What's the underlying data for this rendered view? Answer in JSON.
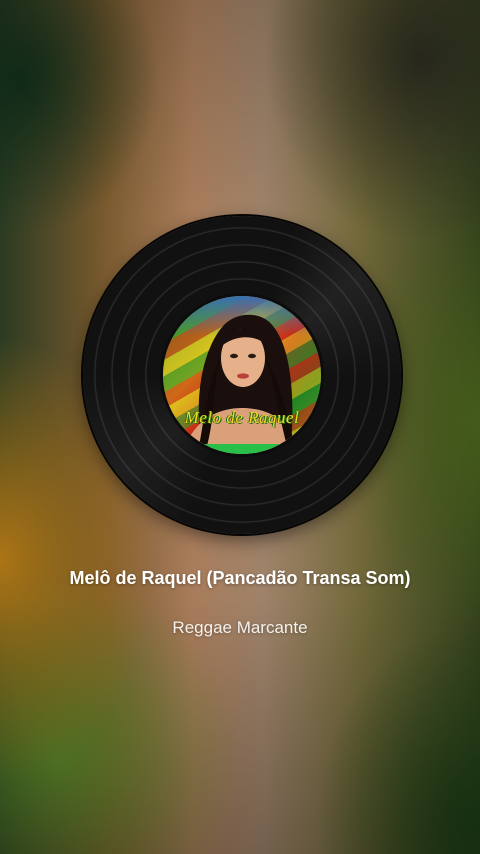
{
  "player": {
    "track_title": "Melô de Raquel (Pancadão Transa Som)",
    "artist": "Reggae Marcante",
    "album_art_text": "Melo de Raquel"
  },
  "colors": {
    "title_text": "#ffffff",
    "artist_text": "#f4f1ee",
    "vinyl": "#111111",
    "label_text": "#f2d81e"
  },
  "icons": {
    "vinyl": "vinyl-record-icon"
  }
}
